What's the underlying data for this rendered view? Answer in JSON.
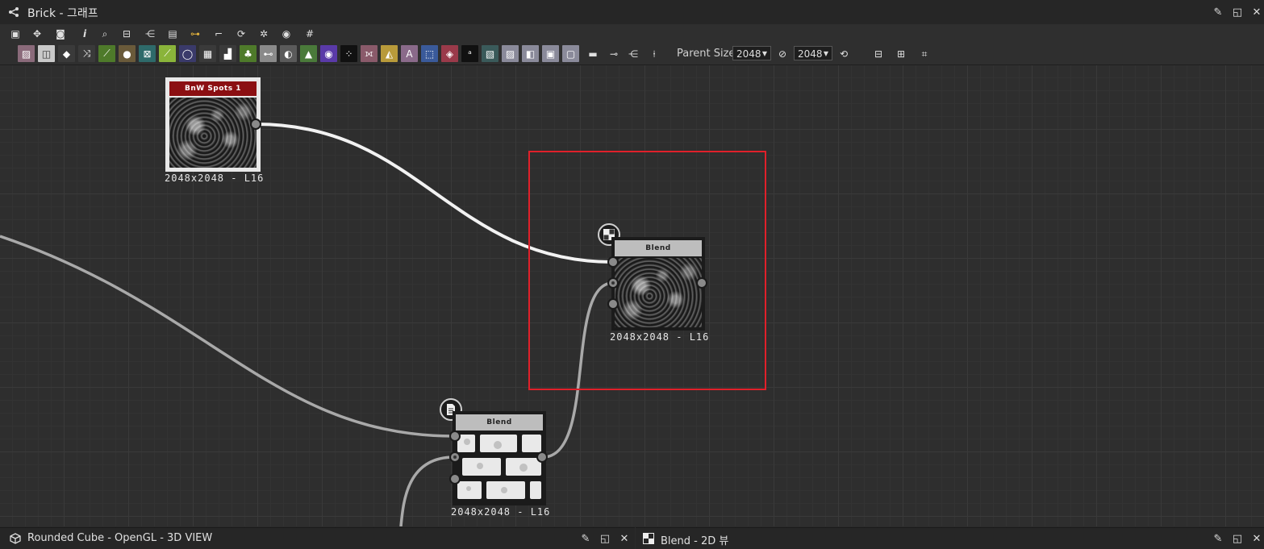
{
  "window": {
    "title": "Brick - 그래프"
  },
  "parent_size": {
    "label": "Parent Size:",
    "width_value": "2048",
    "height_value": "2048"
  },
  "nodes": {
    "bnw_spots": {
      "header": "BnW Spots 1",
      "caption": "2048x2048 - L16",
      "header_color": "#8b0f12"
    },
    "blend_top": {
      "header": "Blend",
      "caption": "2048x2048 - L16",
      "header_color": "#bdbdbd"
    },
    "blend_bottom": {
      "header": "Blend",
      "caption": "2048x2048 - L16",
      "header_color": "#bdbdbd"
    }
  },
  "bottom_panels": {
    "view3d": {
      "label": "Rounded Cube - OpenGL - 3D VIEW"
    },
    "view2d": {
      "label": "Blend - 2D 뷰"
    }
  },
  "colors": {
    "selection": "#e0202a",
    "canvas_bg": "#2e2e2e"
  }
}
